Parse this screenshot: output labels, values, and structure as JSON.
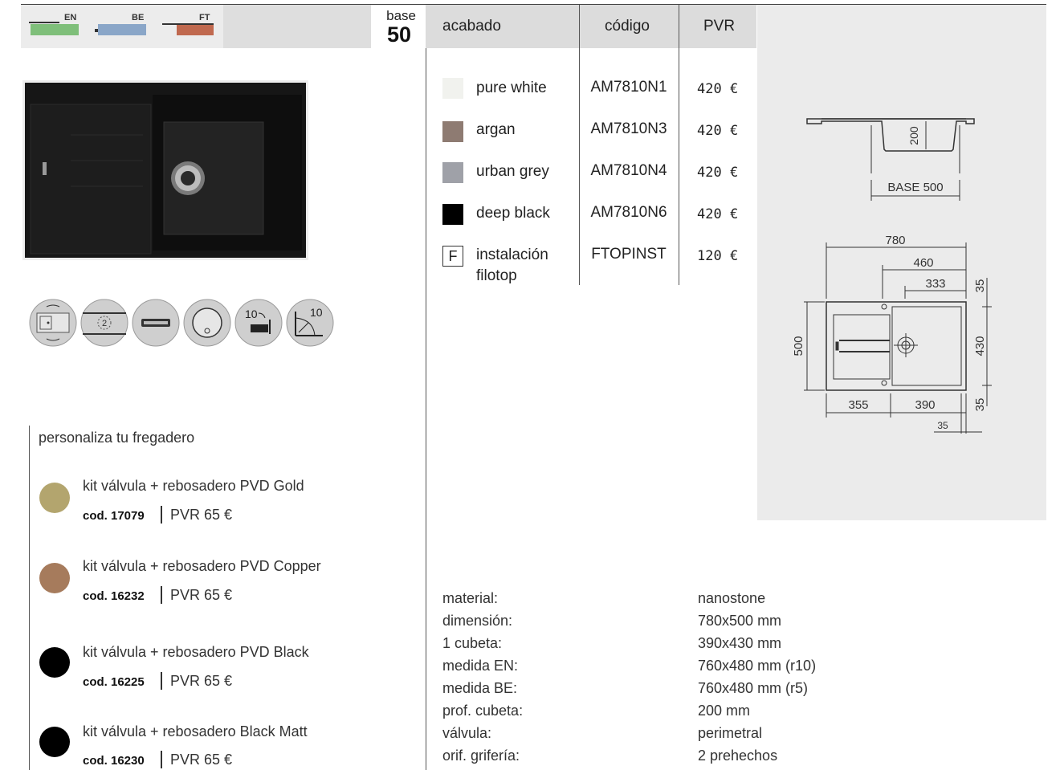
{
  "header": {
    "mount_types": [
      "EN",
      "BE",
      "FT"
    ],
    "mount_colors": {
      "EN": "#7fbf7a",
      "BE": "#8aa6c8",
      "FT": "#c0694f"
    },
    "base_label": "base",
    "base_value": "50"
  },
  "table": {
    "col_finish": "acabado",
    "col_code": "código",
    "col_price": "PVR",
    "rows": [
      {
        "finish": "pure white",
        "code": "AM7810N1",
        "price": "420 €",
        "color": "#f1f2ee"
      },
      {
        "finish": "argan",
        "code": "AM7810N3",
        "price": "420 €",
        "color": "#8e7b72"
      },
      {
        "finish": "urban grey",
        "code": "AM7810N4",
        "price": "420 €",
        "color": "#9fa1a8"
      },
      {
        "finish": "deep black",
        "code": "AM7810N6",
        "price": "420 €",
        "color": "#000000"
      },
      {
        "marker": "F",
        "finish_line1": "instalación",
        "finish_line2": "filotop",
        "code": "FTOPINST",
        "price": "120 €"
      }
    ]
  },
  "drawing": {
    "section": {
      "depth": "200",
      "base": "BASE 500"
    },
    "plan": {
      "total_width": "780",
      "bowl_outer": "460",
      "bowl_width": "333",
      "top_margin": "35",
      "depth": "500",
      "bowl_depth": "430",
      "bottom_margin": "35",
      "left_part": "355",
      "bowl_part": "390",
      "right_margin": "35"
    }
  },
  "feature_icons": [
    "reversible-icon",
    "two-holes-icon",
    "piador-icon",
    "round-valve-icon",
    "radius-10-icon",
    "corner-radius-10-icon"
  ],
  "accessories": {
    "title": "personaliza tu fregadero",
    "items": [
      {
        "name": "kit válvula + rebosadero PVD Gold",
        "code": "cod. 17079",
        "pvr": "PVR 65 €",
        "color": "#b3a56e"
      },
      {
        "name": "kit válvula + rebosadero PVD Copper",
        "code": "cod. 16232",
        "pvr": "PVR 65 €",
        "color": "#a67b5c"
      },
      {
        "name": "kit válvula + rebosadero PVD Black",
        "code": "cod. 16225",
        "pvr": "PVR 65 €",
        "color": "#000000"
      },
      {
        "name": "kit válvula + rebosadero Black Matt",
        "code": "cod. 16230",
        "pvr": "PVR 65 €",
        "color": "#000000"
      }
    ]
  },
  "specs": [
    {
      "label": "material:",
      "value": "nanostone"
    },
    {
      "label": "dimensión:",
      "value": "780x500 mm"
    },
    {
      "label": "1 cubeta:",
      "value": "390x430 mm"
    },
    {
      "label": "medida EN:",
      "value": "760x480 mm (r10)"
    },
    {
      "label": "medida BE:",
      "value": "760x480 mm (r5)"
    },
    {
      "label": "prof. cubeta:",
      "value": "200 mm"
    },
    {
      "label": "válvula:",
      "value": "perimetral"
    },
    {
      "label": "orif. grifería:",
      "value": "2 prehechos"
    }
  ]
}
